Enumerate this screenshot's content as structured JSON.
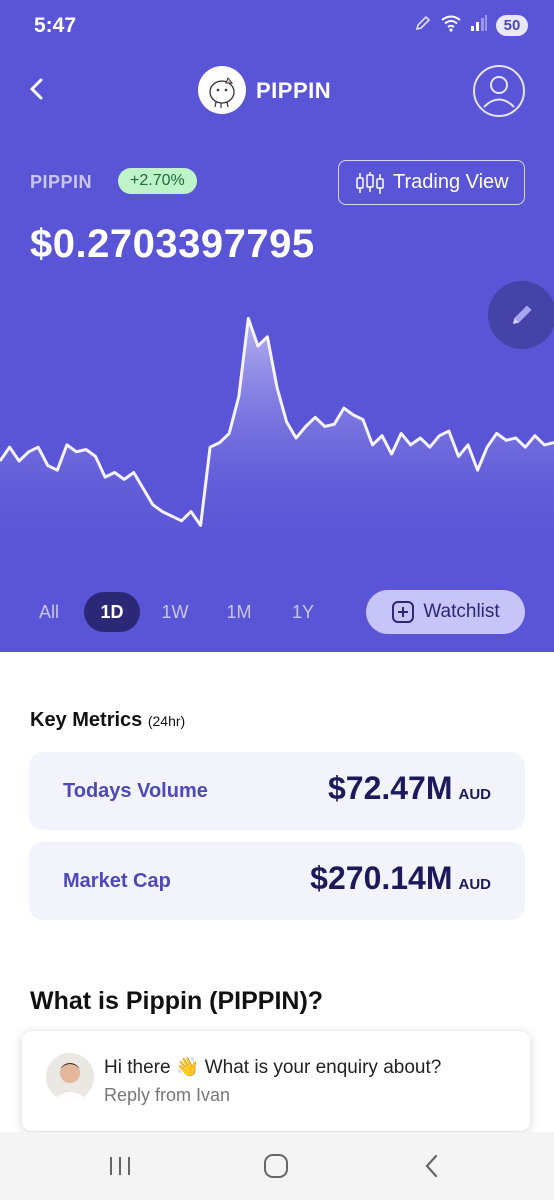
{
  "status": {
    "time": "5:47",
    "battery": "50"
  },
  "header": {
    "title": "PIPPIN"
  },
  "coin": {
    "ticker": "PIPPIN",
    "change": "+2.70%",
    "trading_view_label": "Trading View",
    "price": "$0.2703397795"
  },
  "chart_data": {
    "type": "area",
    "title": "",
    "xlabel": "",
    "ylabel": "",
    "ylim": [
      0,
      100
    ],
    "range": "1D",
    "series": [
      {
        "values": [
          30,
          36,
          30,
          34,
          36,
          28,
          26,
          37,
          34,
          35,
          32,
          23,
          25,
          22,
          25,
          18,
          11,
          8,
          6,
          4,
          8,
          2,
          36,
          38,
          42,
          58,
          92,
          80,
          84,
          62,
          47,
          40,
          45,
          49,
          45,
          46,
          53,
          50,
          48,
          37,
          41,
          33,
          42,
          37,
          40,
          36,
          41,
          43,
          32,
          37,
          26,
          36,
          42,
          39,
          40,
          36,
          41,
          37,
          38
        ]
      }
    ],
    "colors": {
      "line": "#f4f3ff",
      "fill_top": "#c7c3f7",
      "fill_bottom": "#5a55d6"
    }
  },
  "ranges": [
    {
      "label": "All",
      "active": false
    },
    {
      "label": "1D",
      "active": true
    },
    {
      "label": "1W",
      "active": false
    },
    {
      "label": "1M",
      "active": false
    },
    {
      "label": "1Y",
      "active": false
    }
  ],
  "watchlist_label": "Watchlist",
  "metrics": {
    "title": "Key Metrics",
    "subtitle": "(24hr)",
    "items": [
      {
        "label": "Todays Volume",
        "value": "$72.47M",
        "currency": "AUD"
      },
      {
        "label": "Market Cap",
        "value": "$270.14M",
        "currency": "AUD"
      }
    ]
  },
  "about_title": "What is Pippin (PIPPIN)?",
  "chat": {
    "message": "Hi there 👋 What is your enquiry about?",
    "from": "Reply from Ivan"
  },
  "theme": {
    "accent": "#5a55d6",
    "accent_dark": "#2b2878",
    "positive": "#bff3c8"
  }
}
